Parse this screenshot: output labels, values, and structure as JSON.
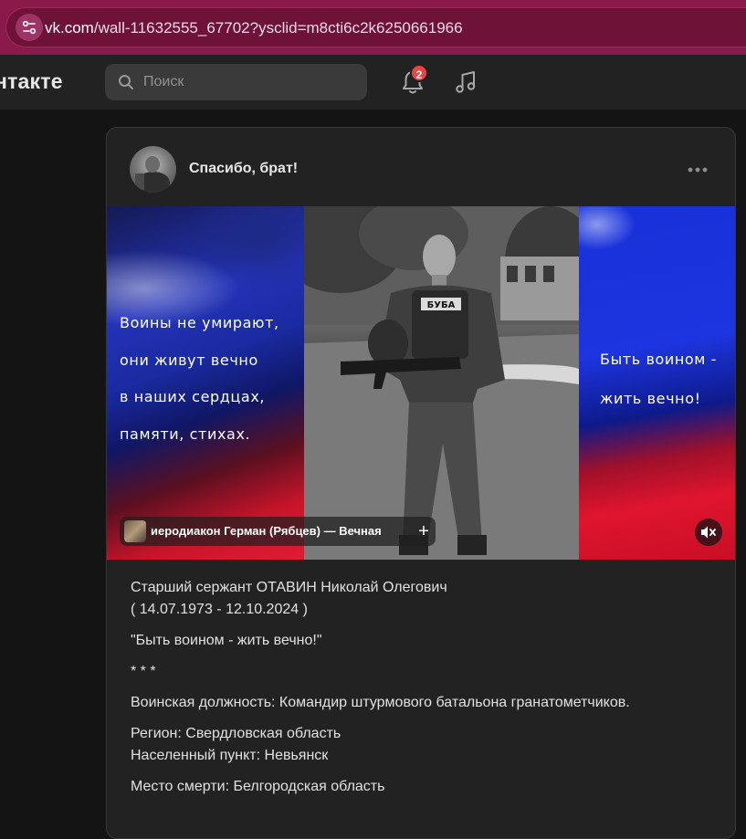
{
  "browser": {
    "url_host": "vk.com",
    "url_path": "/wall-11632555_67702?ysclid=m8cti6c2k6250661966",
    "site_icon": "site-settings-icon"
  },
  "header": {
    "logo_text": "нтакте",
    "search_placeholder": "Поиск",
    "notifications_count": "2",
    "icons": [
      "search-icon",
      "bell-icon",
      "music-icon"
    ]
  },
  "post": {
    "title": "Спасибо, брат!",
    "image_text_left": [
      "Воины не умирают,",
      "они живут вечно",
      "в наших сердцах,",
      "памяти, стихах."
    ],
    "image_text_right": [
      "Быть воином -",
      "жить вечно!"
    ],
    "image_badge": "БУБА",
    "audio_title": "иеродиакон Герман (Рябцев) — Вечная",
    "audio_add_label": "+",
    "body": {
      "line1": "Старший сержант ОТАВИН Николай Олегович",
      "line2": "( 14.07.1973 - 12.10.2024 )",
      "quote": "\"Быть воином - жить вечно!\"",
      "separator": "* * *",
      "position": "Воинская должность: Командир штурмового батальона гранатометчиков.",
      "region": "Регион: Свердловская область",
      "locality": "Населенный пункт: Невьянск",
      "death_place": "Место смерти: Белгородская область"
    }
  },
  "colors": {
    "browser_bar": "#8a1a4a",
    "header_bg": "#222222",
    "card_bg": "#222222",
    "page_bg": "#141414",
    "badge": "#e64646"
  }
}
